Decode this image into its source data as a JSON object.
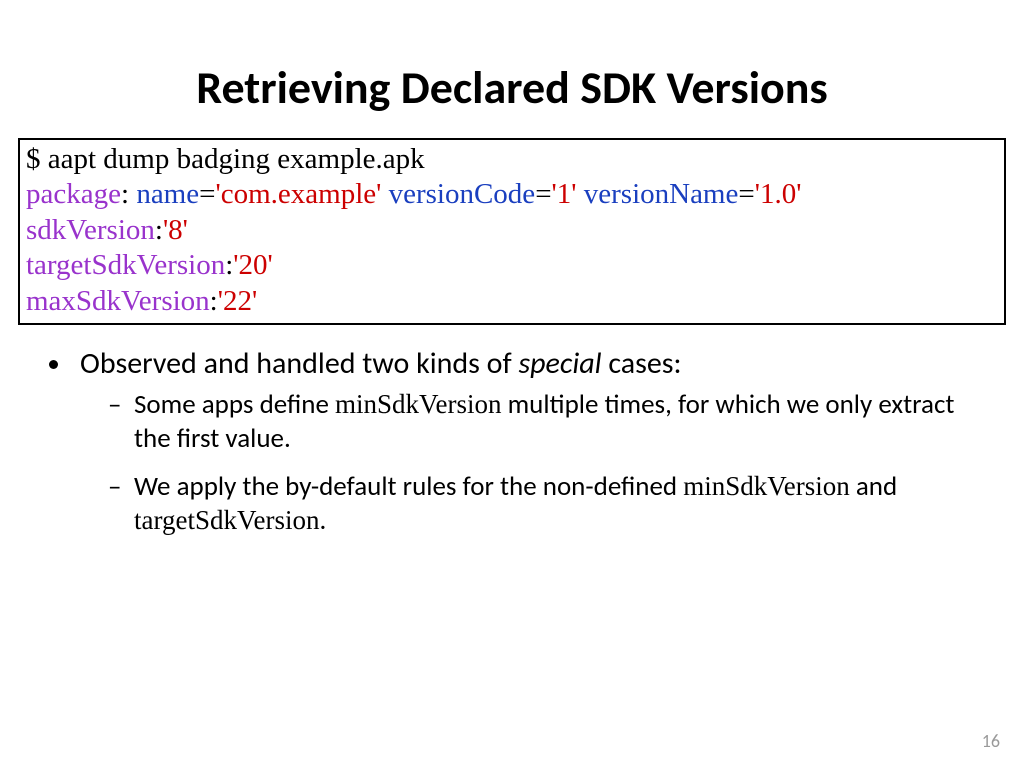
{
  "title": "Retrieving Declared SDK Versions",
  "code": {
    "prompt": "$ aapt dump badging example.apk",
    "kw_package": "package",
    "attr_name": "name",
    "val_name": "'com.example'",
    "attr_vcode": "versionCode",
    "val_vcode": "'1'",
    "attr_vname": "versionName",
    "val_vname": "'1.0'",
    "kw_sdk": "sdkVersion",
    "val_sdk": "'8'",
    "kw_tsdk": "targetSdkVersion",
    "val_tsdk": "'20'",
    "kw_msdk": "maxSdkVersion",
    "val_msdk": "'22'"
  },
  "bullet1_pre": "Observed and handled two kinds of ",
  "bullet1_em": "special",
  "bullet1_post": " cases:",
  "sub1_a": "Some apps define ",
  "sub1_code": "minSdkVersion",
  "sub1_b": " multiple times, for which we only extract the first value.",
  "sub2_a": "We apply the by-default rules for the non-defined ",
  "sub2_code1": "minSdkVersion",
  "sub2_mid": " and ",
  "sub2_code2": "targetSdkVersion",
  "sub2_end": ".",
  "page": "16"
}
